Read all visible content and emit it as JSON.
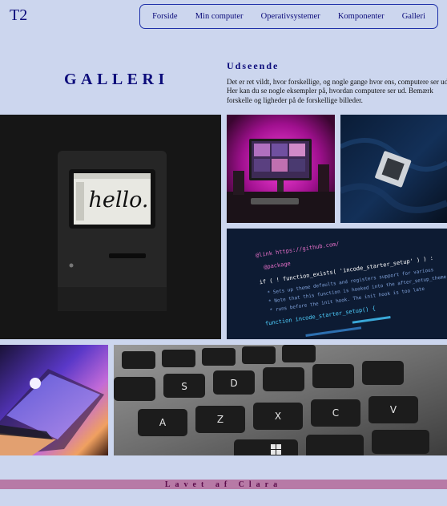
{
  "header": {
    "logo": "T2",
    "nav": [
      {
        "label": "Forside"
      },
      {
        "label": "Min computer"
      },
      {
        "label": "Operativsystemer"
      },
      {
        "label": "Komponenter"
      },
      {
        "label": "Galleri"
      }
    ]
  },
  "intro": {
    "title": "GALLERI",
    "heading": "Udseende",
    "text": "Det er ret vildt, hvor forskellige, og nogle gange hvor ens, computere ser ud. Her kan du se nogle eksempler på, hvordan computere ser ud. Bemærk forskelle og ligheder på de forskellige billeder."
  },
  "gallery": {
    "images": [
      {
        "name": "classic-mac-photo",
        "caption_on_screen": "hello."
      },
      {
        "name": "pink-desk-setup-photo"
      },
      {
        "name": "cpu-chip-photo"
      },
      {
        "name": "code-screen-photo"
      },
      {
        "name": "colorful-laptop-photo"
      },
      {
        "name": "keyboard-closeup-photo"
      }
    ],
    "code_lines": [
      "@link https://github.com/",
      "@package",
      "if ( ! function_exists( 'incode_starter_setup' ) ) :",
      "* Sets up theme defaults and registers support for various",
      "* Note that this function is hooked into the after_setup_theme",
      "* runs before the init hook. The init hook is too late",
      "function incode_starter_setup() {"
    ],
    "keyboard_keys": [
      "A",
      "Z",
      "X",
      "S",
      "D",
      "C",
      "V"
    ]
  },
  "footer": {
    "text": "Lavet af Clara"
  },
  "colors": {
    "background": "#ccd6ee",
    "accent": "#0b0b7a",
    "footer_bar": "#b77aa6"
  }
}
